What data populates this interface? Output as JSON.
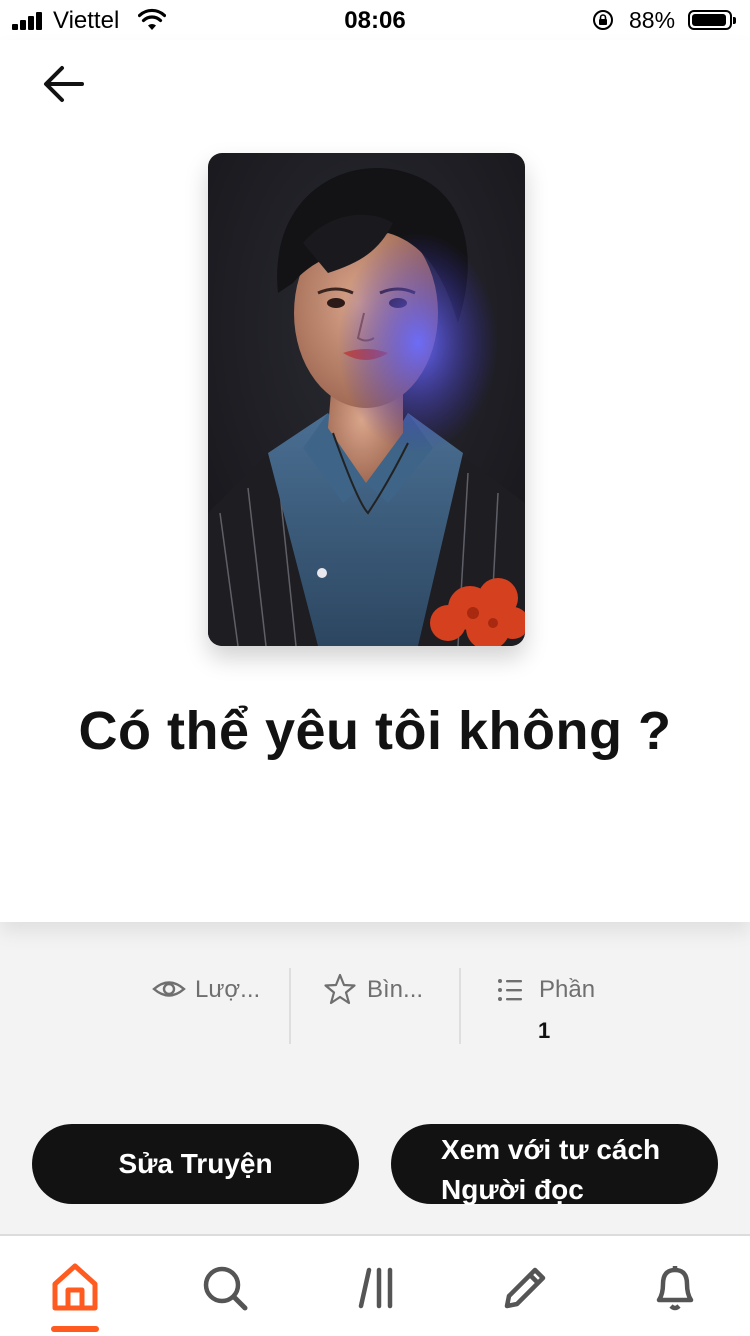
{
  "status_bar": {
    "carrier": "Viettel",
    "time": "08:06",
    "battery_percent": "88%",
    "battery_level": 0.88
  },
  "header": {
    "back_icon": "arrow-left-icon"
  },
  "story": {
    "cover_description": "portrait-cover-image",
    "title": "Có thể yêu tôi không ?"
  },
  "stats": {
    "reads": {
      "icon": "eye-icon",
      "label": "Lượ..."
    },
    "votes": {
      "icon": "star-icon",
      "label": "Bìn..."
    },
    "parts": {
      "icon": "list-icon",
      "label": "Phần",
      "value": "1"
    }
  },
  "actions": {
    "edit_label": "Sửa Truyện",
    "view_label_line1": "Xem với tư cách",
    "view_label_line2": "Người đọc"
  },
  "bottom_nav": {
    "items": [
      {
        "icon": "home-icon",
        "active": true,
        "color": "#ff5a1f"
      },
      {
        "icon": "search-icon",
        "active": false
      },
      {
        "icon": "library-icon",
        "active": false
      },
      {
        "icon": "pencil-icon",
        "active": false
      },
      {
        "icon": "bell-icon",
        "active": false
      }
    ]
  },
  "colors": {
    "accent": "#ff5a1f",
    "button_bg": "#121212",
    "page_bg": "#f3f3f3"
  }
}
